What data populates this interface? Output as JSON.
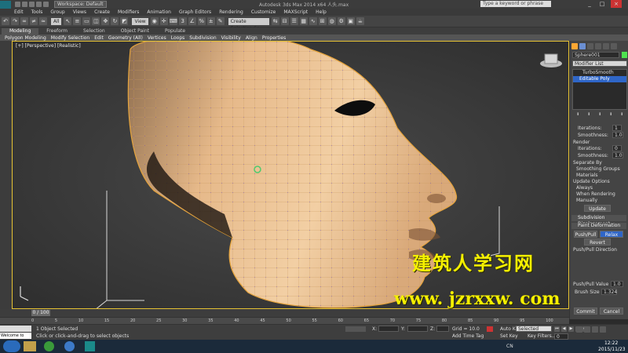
{
  "titlebar": {
    "workspace": "Workspace: Default",
    "app_title": "Autodesk 3ds Max 2014 x64  人头.max",
    "search_placeholder": "Type a keyword or phrase",
    "min": "_",
    "max": "□",
    "close": "×"
  },
  "menu": [
    "Edit",
    "Tools",
    "Group",
    "Views",
    "Create",
    "Modifiers",
    "Animation",
    "Graph Editors",
    "Rendering",
    "Customize",
    "MAXScript",
    "Help"
  ],
  "toolbar": {
    "filter": "All",
    "refcoord": "View",
    "selset": "Create Selection Se"
  },
  "ribbon": {
    "tabs": [
      "Modeling",
      "Freeform",
      "Selection",
      "Object Paint",
      "Populate"
    ],
    "panel_items": [
      "Polygon Modeling",
      "Modify Selection",
      "Edit",
      "Geometry (All)",
      "Vertices",
      "Loops",
      "Subdivision",
      "Visibility",
      "Align",
      "Properties"
    ]
  },
  "viewport": {
    "label": "[+] [Perspective] [Realistic]"
  },
  "cmdpanel": {
    "object_name": "Sphere001",
    "modifier_list": "Modifier List",
    "stack": [
      "TurboSmooth",
      "Editable Poly"
    ],
    "iterations_label": "Iterations:",
    "iterations_val": "1",
    "smoothness_label": "Smoothness:",
    "smoothness_val": "1.0",
    "render_label": "Render",
    "r_iterations_label": "Iterations:",
    "r_iterations_val": "0",
    "r_smoothness_label": "Smoothness:",
    "r_smoothness_val": "1.0",
    "separate_by": "Separate By",
    "smoothing_groups": "Smoothing Groups",
    "materials": "Materials",
    "update_options": "Update Options",
    "always": "Always",
    "when_rendering": "When Rendering",
    "manually": "Manually",
    "update_btn": "Update",
    "subdiv_disp": "Subdivision Displacement",
    "paint_deform": "Paint Deformation",
    "push_pull": "Push/Pull",
    "relax": "Relax",
    "revert": "Revert",
    "push_pull_dir": "Push/Pull Direction",
    "push_pull_value": "Push/Pull Value",
    "push_pull_val": "1.0",
    "brush_size": "Brush Size",
    "brush_size_val": "1.324",
    "commit": "Commit",
    "cancel": "Cancel"
  },
  "timeline": {
    "frame": "0 / 100",
    "ticks": [
      "0",
      "5",
      "10",
      "15",
      "20",
      "25",
      "30",
      "35",
      "40",
      "45",
      "50",
      "55",
      "60",
      "65",
      "70",
      "75",
      "80",
      "85",
      "90",
      "95",
      "100"
    ]
  },
  "status": {
    "selected": "1 Object Selected",
    "hint": "Click or click-and-drag to select objects",
    "welcome": "Welcome to MAXScript",
    "x_label": "X:",
    "y_label": "Y:",
    "z_label": "Z:",
    "grid": "Grid = 10.0",
    "add_time_tag": "Add Time Tag",
    "auto_key": "Auto Key",
    "set_key": "Set Key",
    "selected_dd": "Selected",
    "key_filters": "Key Filters...",
    "frame_val": "0"
  },
  "taskbar": {
    "time": "12:22",
    "date": "2015/11/23",
    "lang": "CN"
  },
  "watermark": {
    "line1": "建筑人学习网",
    "line2": "www. jzrxxw. com"
  },
  "colors": {
    "accent": "#e6c233",
    "head": "#e6b98a",
    "watermark": "#f5f000"
  }
}
